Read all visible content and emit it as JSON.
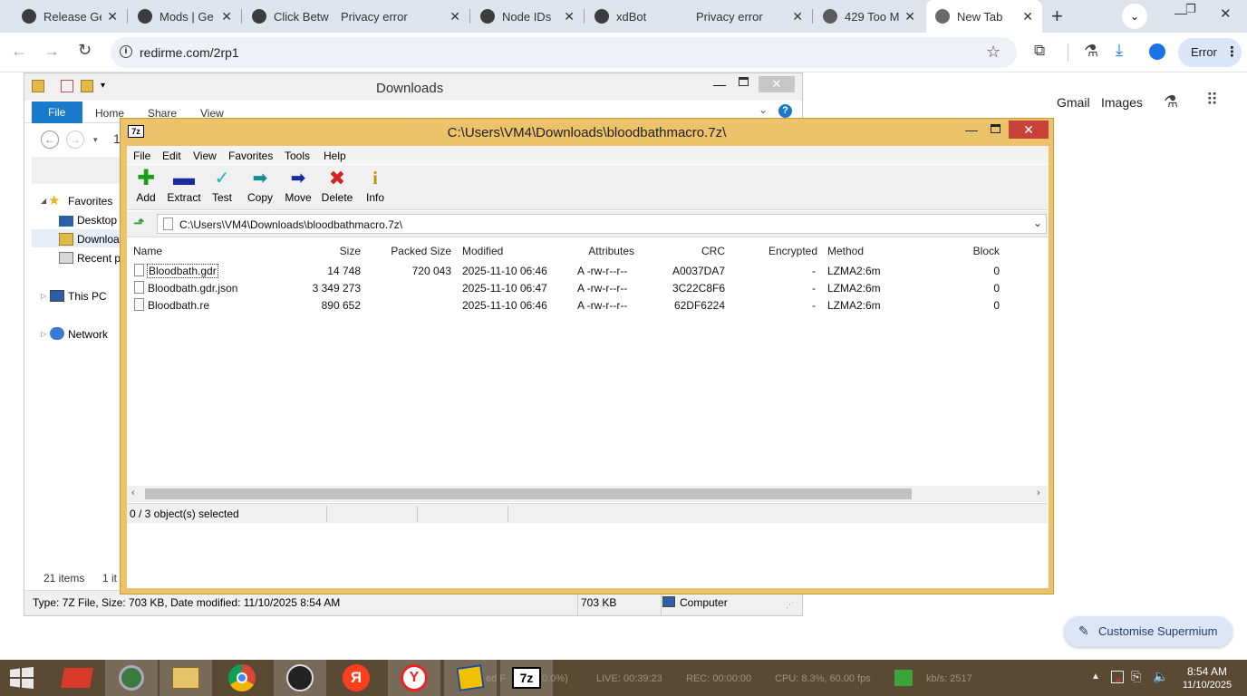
{
  "browser": {
    "tabs": [
      {
        "title": "Release Ge",
        "icon": "github-icon"
      },
      {
        "title": "Mods | Ge",
        "icon": "site-icon"
      },
      {
        "title": "Click Betw",
        "icon": "site-icon"
      },
      {
        "title": "Privacy error",
        "icon": ""
      },
      {
        "title": "Node IDs",
        "icon": "site-icon"
      },
      {
        "title": "xdBot",
        "icon": "site-icon"
      },
      {
        "title": "Privacy error",
        "icon": ""
      },
      {
        "title": "429 Too M",
        "icon": "globe-icon"
      },
      {
        "title": "New Tab",
        "icon": "chromium-icon"
      }
    ],
    "url": "redirme.com/2rp1",
    "profile_status": "Error",
    "ntp_links": {
      "gmail": "Gmail",
      "images": "Images"
    },
    "customise_label": "Customise Supermium"
  },
  "explorer": {
    "title": "Downloads",
    "ribbon_tabs": {
      "file": "File",
      "home": "Home",
      "share": "Share",
      "view": "View"
    },
    "nav": {
      "favorites": "Favorites",
      "desktop": "Desktop",
      "downloads": "Downloa",
      "recent": "Recent p",
      "this_pc": "This PC",
      "network": "Network"
    },
    "nav_number": "1",
    "items_count": "21 items",
    "selected_count": "1 it",
    "status_text": "Type: 7Z File, Size: 703 KB, Date modified: 11/10/2025 8:54 AM",
    "status_size": "703 KB",
    "status_location": "Computer"
  },
  "sevenzip": {
    "title": "C:\\Users\\VM4\\Downloads\\bloodbathmacro.7z\\",
    "menu": {
      "file": "File",
      "edit": "Edit",
      "view": "View",
      "favorites": "Favorites",
      "tools": "Tools",
      "help": "Help"
    },
    "toolbar": {
      "add": "Add",
      "extract": "Extract",
      "test": "Test",
      "copy": "Copy",
      "move": "Move",
      "delete": "Delete",
      "info": "Info"
    },
    "address": "C:\\Users\\VM4\\Downloads\\bloodbathmacro.7z\\",
    "columns": {
      "name": "Name",
      "size": "Size",
      "packed": "Packed Size",
      "modified": "Modified",
      "attributes": "Attributes",
      "crc": "CRC",
      "encrypted": "Encrypted",
      "method": "Method",
      "block": "Block"
    },
    "files": [
      {
        "name": "Bloodbath.gdr",
        "size": "14 748",
        "packed": "720 043",
        "modified": "2025-11-10 06:46",
        "attributes": "A -rw-r--r--",
        "crc": "A0037DA7",
        "encrypted": "-",
        "method": "LZMA2:6m",
        "block": "0"
      },
      {
        "name": "Bloodbath.gdr.json",
        "size": "3 349 273",
        "packed": "",
        "modified": "2025-11-10 06:47",
        "attributes": "A -rw-r--r--",
        "crc": "3C22C8F6",
        "encrypted": "-",
        "method": "LZMA2:6m",
        "block": "0"
      },
      {
        "name": "Bloodbath.re",
        "size": "890 652",
        "packed": "",
        "modified": "2025-11-10 06:46",
        "attributes": "A -rw-r--r--",
        "crc": "62DF6224",
        "encrypted": "-",
        "method": "LZMA2:6m",
        "block": "0"
      }
    ],
    "status": "0 / 3 object(s) selected"
  },
  "taskbar": {
    "obs_stats": {
      "prefix": "ed F",
      "percent": "0.0%)",
      "live": "LIVE: 00:39:23",
      "rec": "REC: 00:00:00",
      "cpu": "CPU: 8.3%, 60.00 fps",
      "kbs": "kb/s: 2517"
    },
    "time": "8:54 AM",
    "date": "11/10/2025"
  }
}
